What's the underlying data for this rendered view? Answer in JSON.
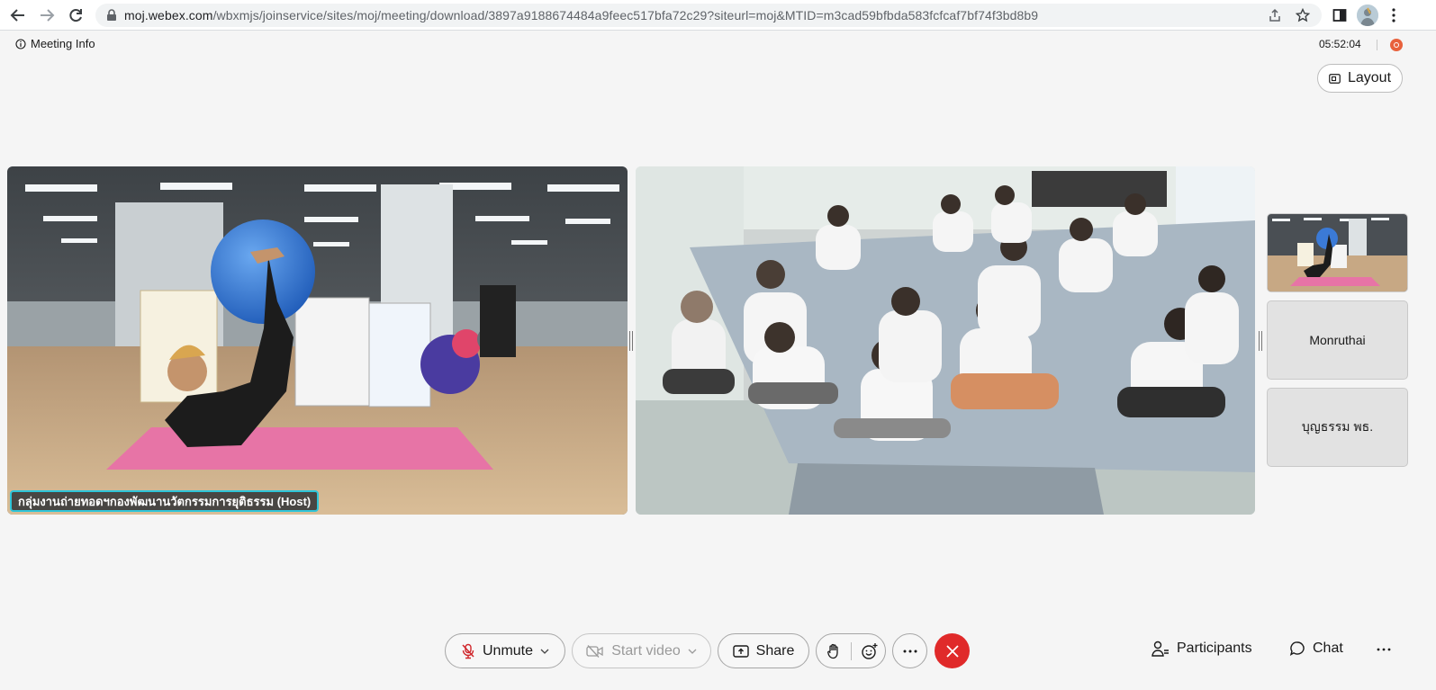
{
  "browser": {
    "url_domain": "moj.webex.com",
    "url_path": "/wbxmjs/joinservice/sites/moj/meeting/download/3897a9188674484a9feec517bfa72c29?siteurl=moj&MTID=m3cad59bfbda583fcfcaf7bf74f3bd8b9"
  },
  "header": {
    "meeting_info_label": "Meeting Info",
    "timer": "05:52:04",
    "layout_label": "Layout"
  },
  "videos": {
    "host_name": "กลุ่มงานถ่ายทอดฯกองพัฒนานวัตกรรมการยุติธรรม (Host)"
  },
  "thumbnails": [
    {
      "name": "Monruthai"
    },
    {
      "name": "บุญธรรม พธ."
    }
  ],
  "controls": {
    "unmute_label": "Unmute",
    "start_video_label": "Start video",
    "share_label": "Share",
    "participants_label": "Participants",
    "chat_label": "Chat"
  },
  "colors": {
    "end_call": "#e02a2a",
    "name_tag_border": "#2ec5d9",
    "recording": "#e8613c"
  }
}
